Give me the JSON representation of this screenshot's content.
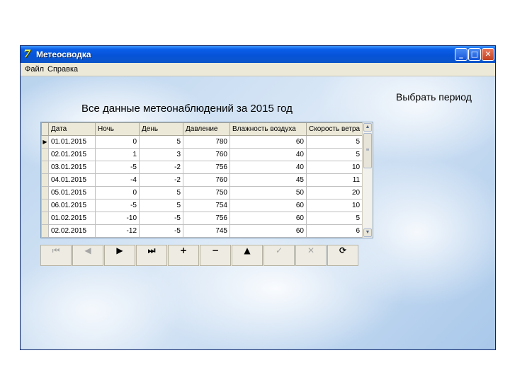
{
  "window": {
    "title": "Метеосводка",
    "icon": "app-icon",
    "buttons": {
      "minimize": "_",
      "maximize": "□",
      "close": "✕"
    }
  },
  "menu": {
    "items": [
      "Файл",
      "Справка"
    ]
  },
  "main": {
    "heading": "Все данные метеонаблюдений за 2015 год",
    "period_link": "Выбрать период"
  },
  "grid": {
    "columns": [
      "Дата",
      "Ночь",
      "День",
      "Давление",
      "Влажность воздуха",
      "Скорость ветра"
    ],
    "rows": [
      [
        "01.01.2015",
        "0",
        "5",
        "780",
        "60",
        "5"
      ],
      [
        "02.01.2015",
        "1",
        "3",
        "760",
        "40",
        "5"
      ],
      [
        "03.01.2015",
        "-5",
        "-2",
        "756",
        "40",
        "10"
      ],
      [
        "04.01.2015",
        "-4",
        "-2",
        "760",
        "45",
        "11"
      ],
      [
        "05.01.2015",
        "0",
        "5",
        "750",
        "50",
        "20"
      ],
      [
        "06.01.2015",
        "-5",
        "5",
        "754",
        "60",
        "10"
      ],
      [
        "01.02.2015",
        "-10",
        "-5",
        "756",
        "60",
        "5"
      ],
      [
        "02.02.2015",
        "-12",
        "-5",
        "745",
        "60",
        "6"
      ]
    ],
    "current_row_marker": "▶",
    "scroll": {
      "up": "▲",
      "down": "▼",
      "thumb": "≡"
    }
  },
  "navigator": {
    "buttons": [
      {
        "name": "nav-first-button",
        "glyph": "⏮",
        "enabled": false
      },
      {
        "name": "nav-prior-button",
        "glyph": "◀",
        "enabled": false
      },
      {
        "name": "nav-next-button",
        "glyph": "▶",
        "enabled": true
      },
      {
        "name": "nav-last-button",
        "glyph": "⏭",
        "enabled": true
      },
      {
        "name": "nav-insert-button",
        "glyph": "+",
        "enabled": true
      },
      {
        "name": "nav-delete-button",
        "glyph": "−",
        "enabled": true
      },
      {
        "name": "nav-edit-button",
        "glyph": "▲",
        "enabled": true
      },
      {
        "name": "nav-post-button",
        "glyph": "✓",
        "enabled": false
      },
      {
        "name": "nav-cancel-button",
        "glyph": "✕",
        "enabled": false
      },
      {
        "name": "nav-refresh-button",
        "glyph": "⟳",
        "enabled": true
      }
    ]
  },
  "colors": {
    "titlebar": "#0653d8",
    "menubar": "#ece9d8",
    "grid_header": "#ece9d8"
  }
}
